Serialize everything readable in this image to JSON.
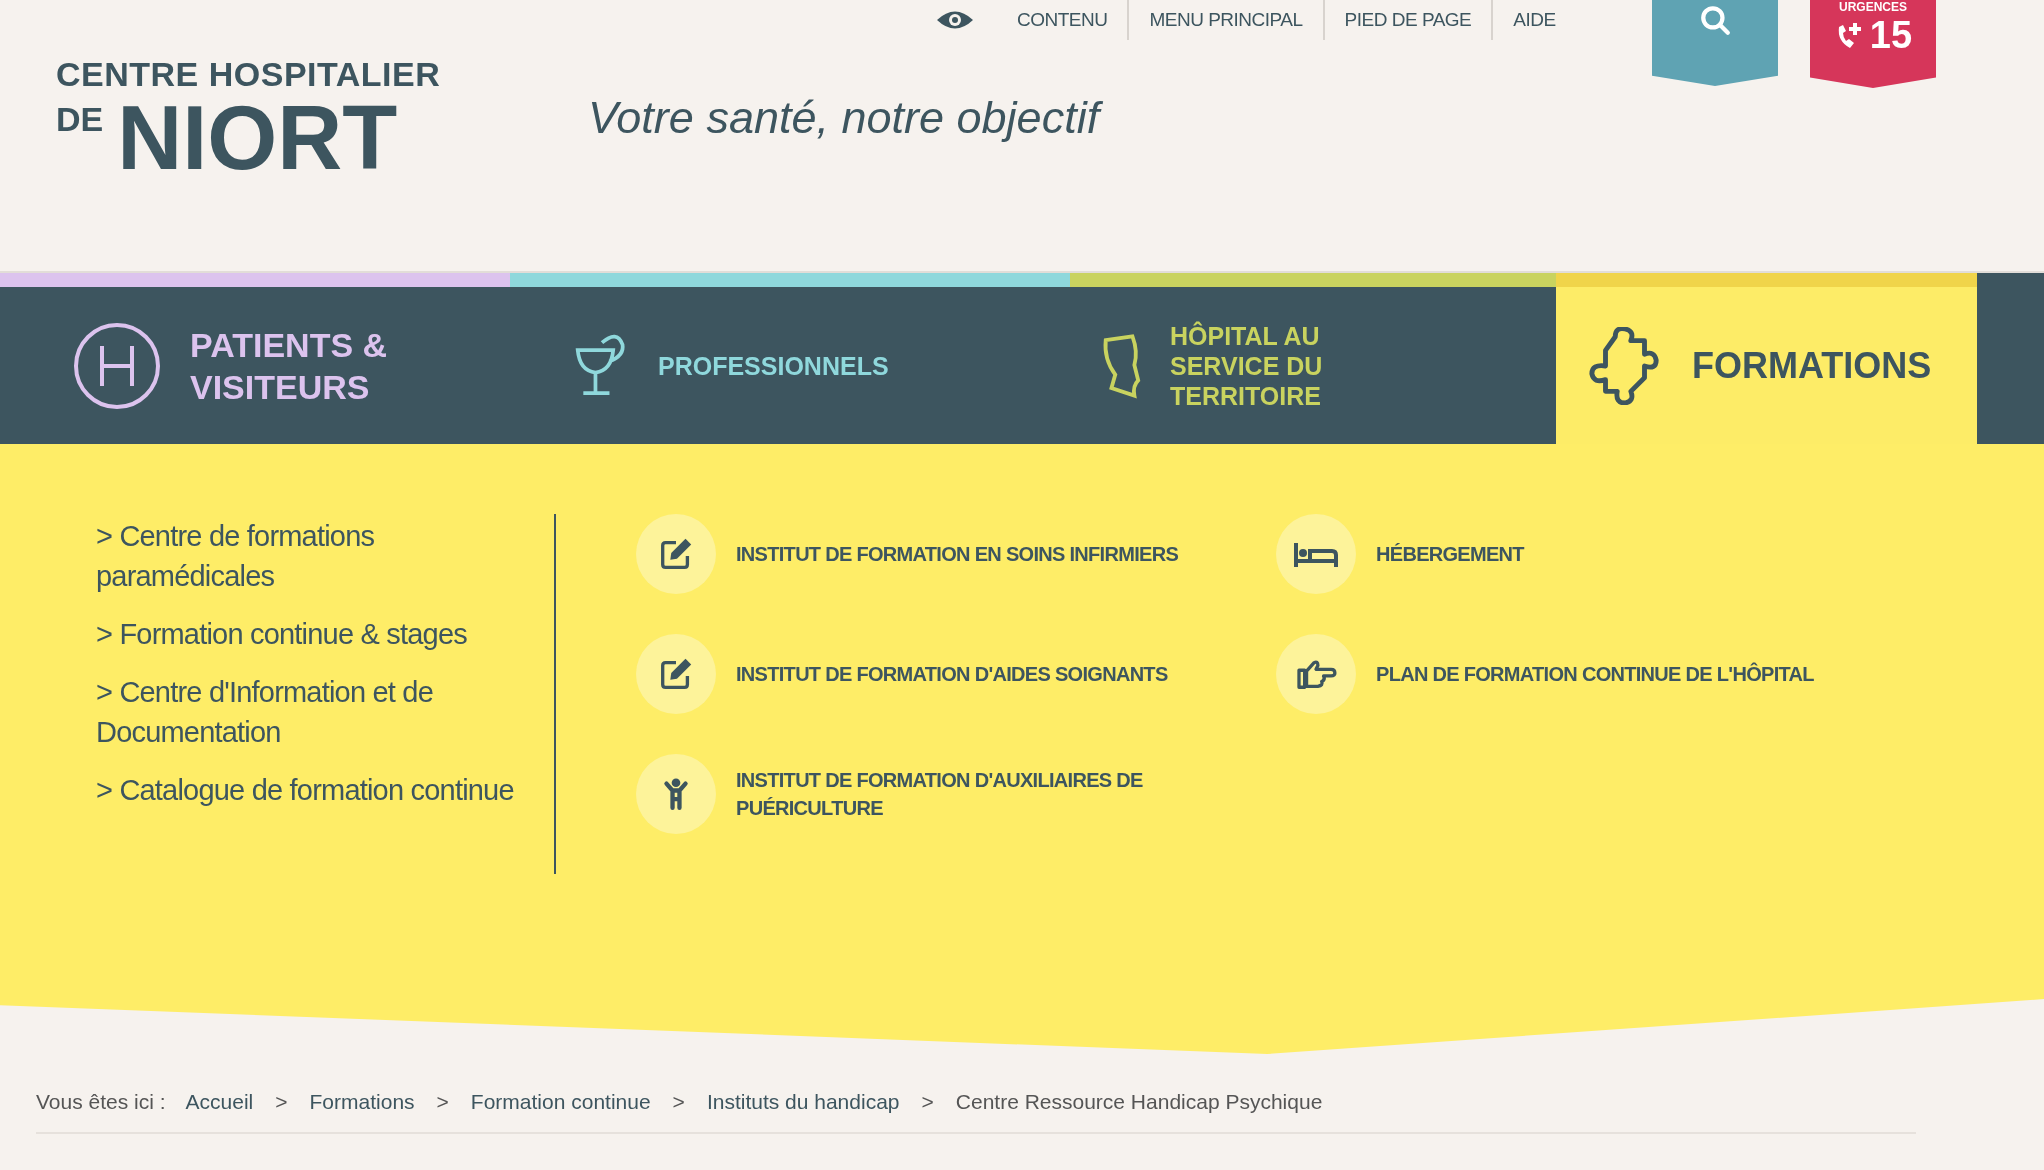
{
  "logo": {
    "line_1": "CENTRE HOSPITALIER",
    "prefix": "DE",
    "name": "NIORT"
  },
  "tagline": "Votre santé, notre objectif",
  "access_links": [
    "CONTENU",
    "MENU PRINCIPAL",
    "PIED DE PAGE",
    "AIDE"
  ],
  "emergency": {
    "label": "URGENCES",
    "number": "15"
  },
  "nav_tabs": [
    {
      "kind": "hospital",
      "label": "PATIENTS & VISITEURS",
      "color": "#dcc3ee",
      "selected": false
    },
    {
      "kind": "caduceus",
      "label": "PROFESSIONNELS",
      "color": "#8fd8dc",
      "selected": false
    },
    {
      "kind": "territory",
      "label": "HÔPITAL AU SERVICE DU TERRITOIRE",
      "color": "#c9d35f",
      "selected": false
    },
    {
      "kind": "puzzle",
      "label": "FORMATIONS",
      "color": "#f0d44a",
      "selected": true
    }
  ],
  "submenu_links": [
    "> Centre de formations paramédicales",
    "> Formation continue & stages",
    "> Centre d'Information et de Documentation",
    "> Catalogue de formation continue"
  ],
  "institutes": [
    {
      "kind": "edit",
      "label": "INSTITUT DE FORMATION EN SOINS INFIRMIERS"
    },
    {
      "kind": "bed",
      "label": "HÉBERGEMENT"
    },
    {
      "kind": "edit",
      "label": "INSTITUT DE FORMATION D'AIDES SOIGNANTS"
    },
    {
      "kind": "hand",
      "label": "PLAN DE FORMATION CONTINUE DE L'HÔPITAL"
    },
    {
      "kind": "child",
      "label": "INSTITUT DE FORMATION D'AUXILIAIRES DE PUÉRICULTURE"
    }
  ],
  "breadcrumb": {
    "prefix": "Vous êtes ici :",
    "links": [
      "Accueil",
      "Formations",
      "Formation continue",
      "Instituts du handicap"
    ],
    "separator": ">",
    "current": "Centre Ressource Handicap Psychique"
  }
}
